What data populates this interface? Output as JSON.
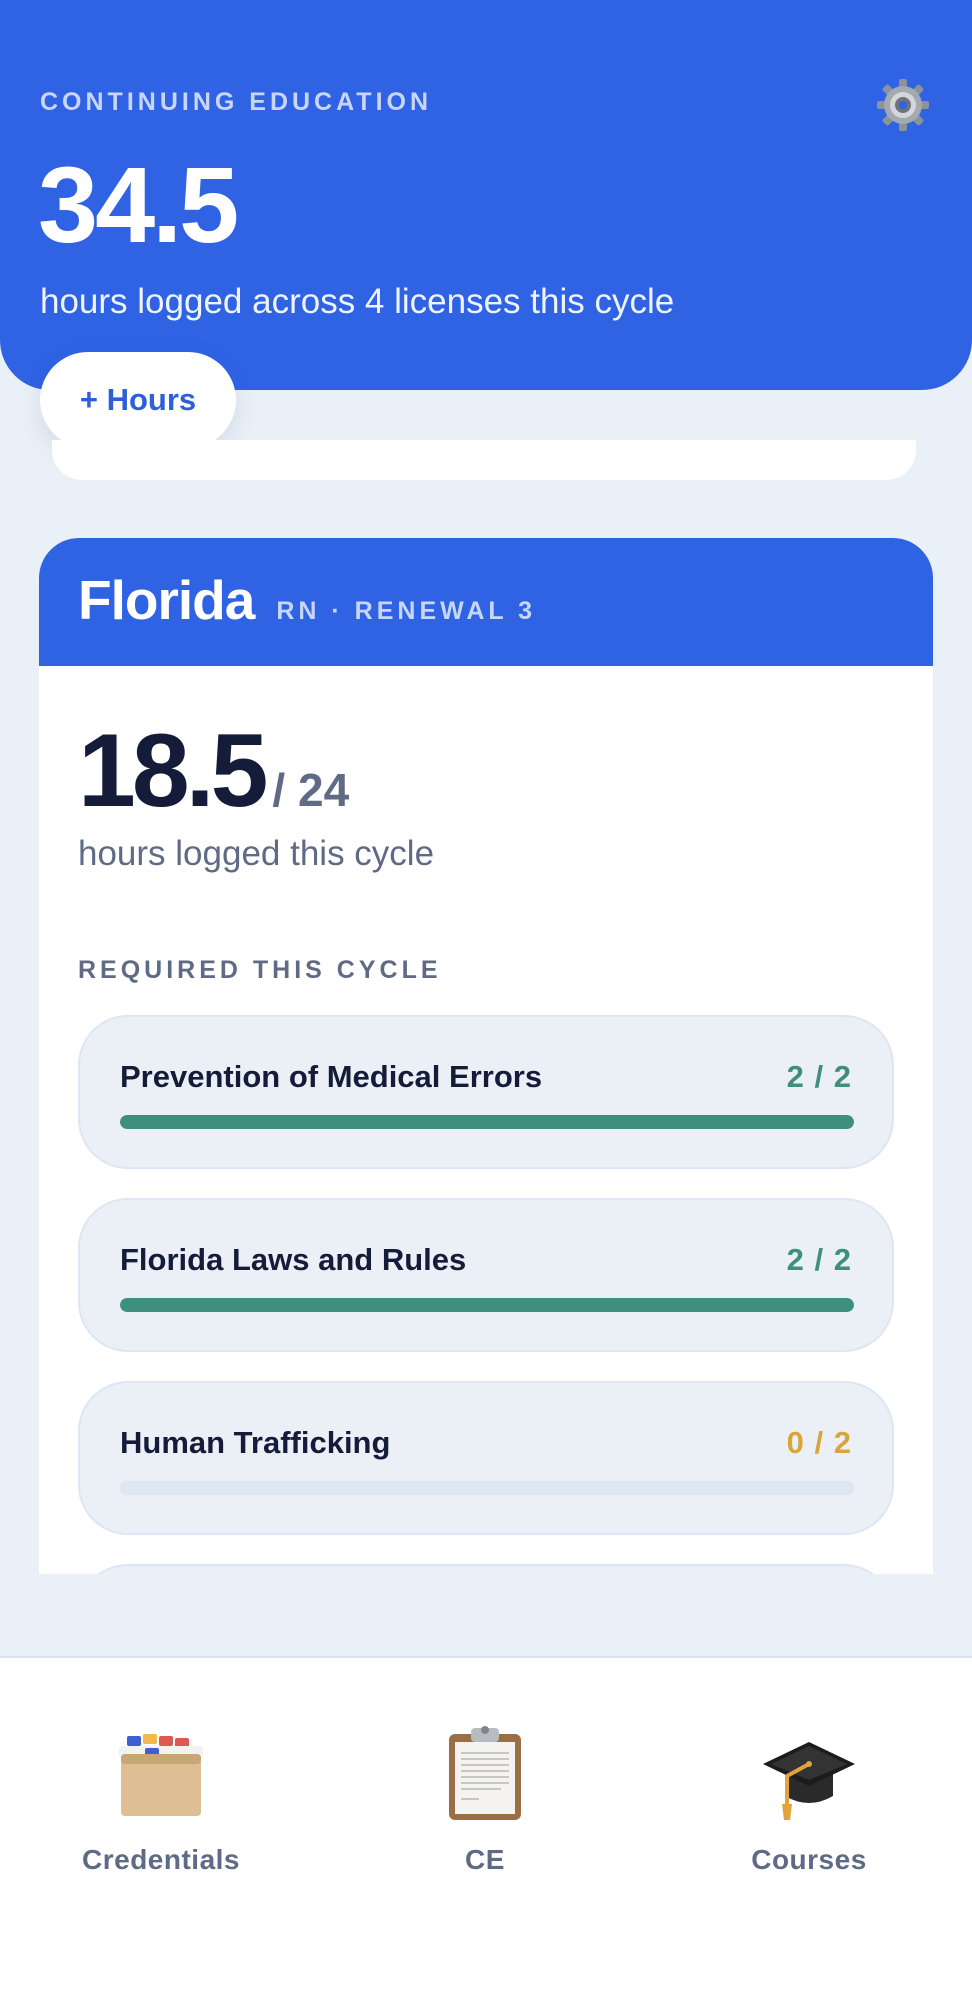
{
  "header": {
    "eyebrow": "CONTINUING EDUCATION",
    "total_hours": "34.5",
    "subtitle": "hours logged across 4 licenses this cycle",
    "add_button": "+ Hours",
    "settings_icon": "gear-icon"
  },
  "license_card": {
    "state": "Florida",
    "meta": "RN · RENEWAL 3",
    "hours_logged": "18.5",
    "hours_required": "/ 24",
    "hours_caption": "hours logged this cycle",
    "required_label": "REQUIRED THIS CYCLE",
    "requirements": [
      {
        "name": "Prevention of Medical Errors",
        "count": "2 / 2",
        "progress": 1.0,
        "status_color": "#3f8f7f"
      },
      {
        "name": "Florida Laws and Rules",
        "count": "2 / 2",
        "progress": 1.0,
        "status_color": "#3f8f7f"
      },
      {
        "name": "Human Trafficking",
        "count": "0 / 2",
        "progress": 0.0,
        "status_color": "#d9a43a"
      }
    ]
  },
  "tabbar": {
    "tabs": [
      {
        "label": "Credentials",
        "icon": "card-file-box-icon"
      },
      {
        "label": "CE",
        "icon": "clipboard-icon"
      },
      {
        "label": "Courses",
        "icon": "graduation-cap-icon"
      }
    ]
  },
  "colors": {
    "accent": "#2f63e4",
    "complete": "#3f8f7f",
    "incomplete": "#d9a43a",
    "background": "#eaf0f7"
  }
}
